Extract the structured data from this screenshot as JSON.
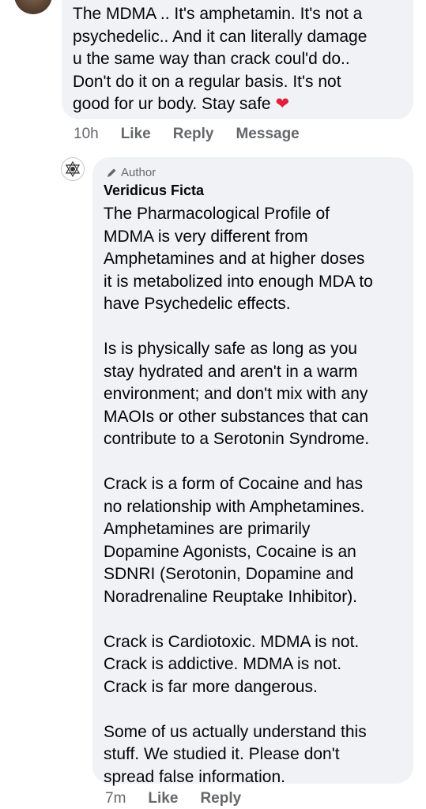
{
  "comment1": {
    "text": "The MDMA .. It's amphetamin. It's not a\npsychedelic.. And it can literally damage\nu the same way than crack coul'd do..\nDon't do it on a regular basis. It's not\ngood for ur body. Stay safe ",
    "emoji": "❤",
    "time": "10h",
    "like": "Like",
    "reply": "Reply",
    "message": "Message"
  },
  "comment2": {
    "badge": "Author",
    "name": "Veridicus Ficta",
    "paragraphs": [
      "The Pharmacological Profile of\nMDMA is very different from\nAmphetamines and at higher doses\nit is metabolized into enough MDA to\nhave Psychedelic effects.",
      "Is is physically safe as long as you\nstay hydrated and aren't in a warm\nenvironment; and don't mix with any\nMAOIs or other substances that can\ncontribute to a Serotonin Syndrome.",
      "Crack is a form of Cocaine and has\nno relationship with Amphetamines.\nAmphetamines are primarily\nDopamine Agonists, Cocaine is an\nSDNRI (Serotonin, Dopamine and\nNoradrenaline Reuptake Inhibitor).",
      "Crack is Cardiotoxic. MDMA is not.\nCrack is addictive. MDMA is not.\nCrack is far more dangerous.",
      "Some of us actually understand this\nstuff. We studied it. Please don't\nspread false information."
    ],
    "time": "7m",
    "like": "Like",
    "reply": "Reply"
  }
}
